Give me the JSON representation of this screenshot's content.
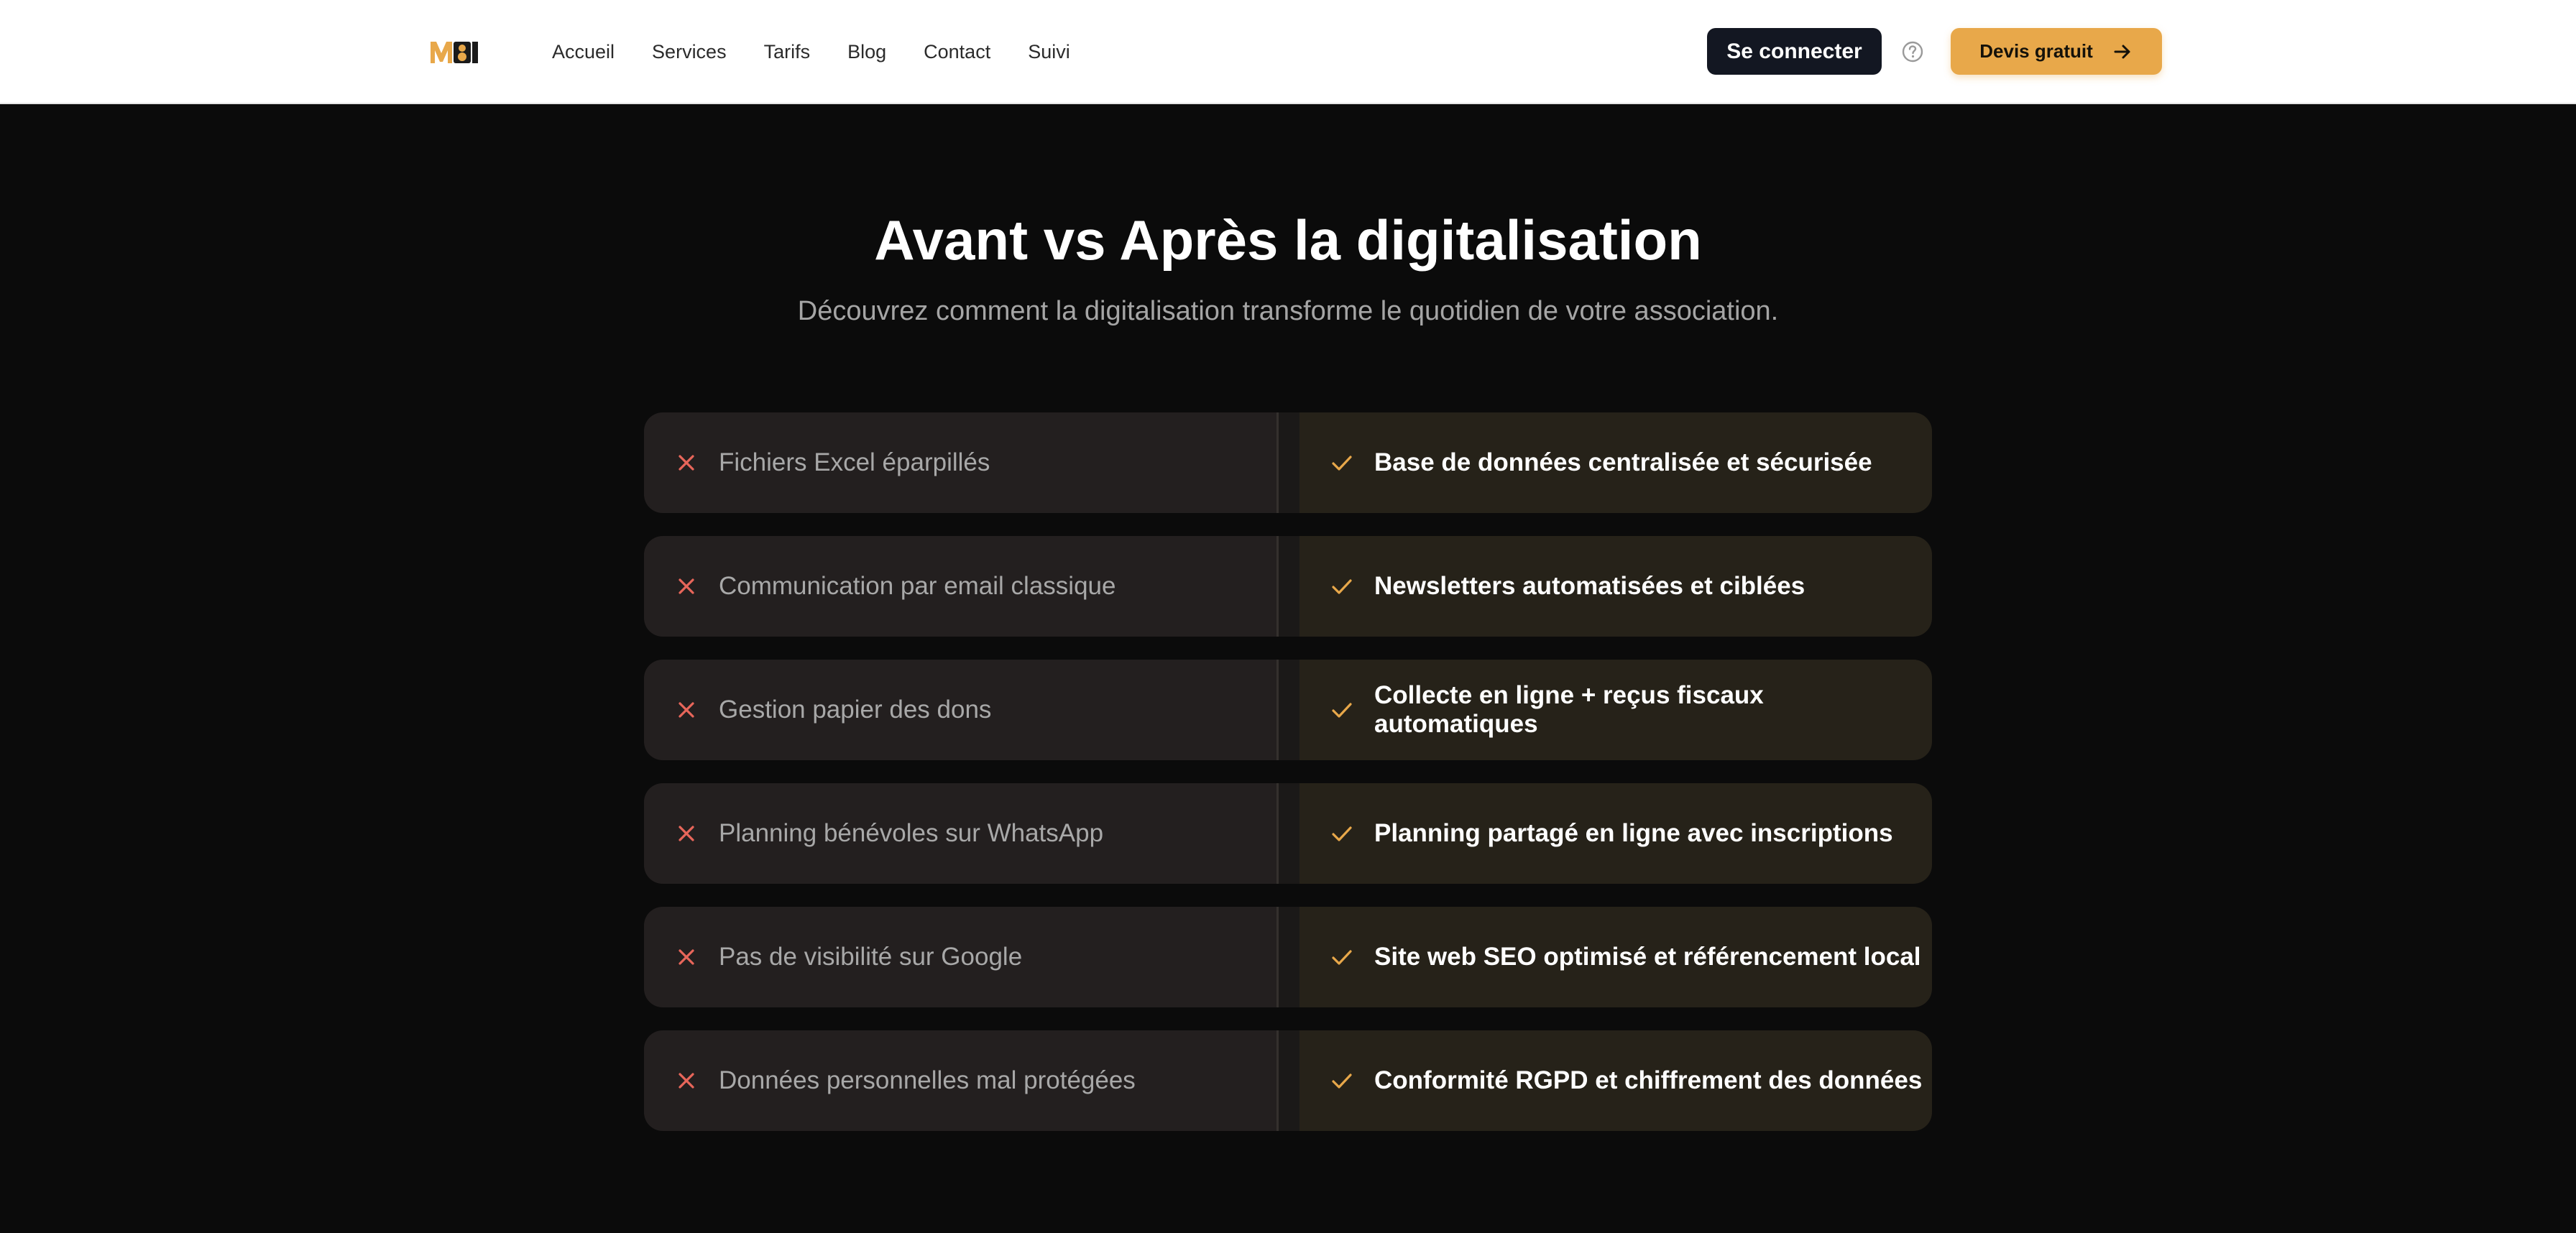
{
  "header": {
    "logo_text": "MBI",
    "nav": [
      {
        "label": "Accueil"
      },
      {
        "label": "Services"
      },
      {
        "label": "Tarifs"
      },
      {
        "label": "Blog"
      },
      {
        "label": "Contact"
      },
      {
        "label": "Suivi"
      }
    ],
    "login_label": "Se connecter",
    "help_icon": "question-circle-icon",
    "quote_label": "Devis gratuit",
    "quote_icon": "arrow-right-icon"
  },
  "colors": {
    "accent": "#e8a84a",
    "dark_button": "#131722",
    "negative_icon": "#e8665a",
    "positive_icon": "#e8a84a",
    "section_bg": "#0b0b0b"
  },
  "section": {
    "title": "Avant vs Après la digitalisation",
    "subtitle": "Découvrez comment la digitalisation transforme le quotidien de votre association.",
    "rows": [
      {
        "before": "Fichiers Excel éparpillés",
        "after": "Base de données centralisée et sécurisée"
      },
      {
        "before": "Communication par email classique",
        "after": "Newsletters automatisées et ciblées"
      },
      {
        "before": "Gestion papier des dons",
        "after": "Collecte en ligne + reçus fiscaux automatiques"
      },
      {
        "before": "Planning bénévoles sur WhatsApp",
        "after": "Planning partagé en ligne avec inscriptions"
      },
      {
        "before": "Pas de visibilité sur Google",
        "after": "Site web SEO optimisé et référencement local"
      },
      {
        "before": "Données personnelles mal protégées",
        "after": "Conformité RGPD et chiffrement des données"
      }
    ]
  }
}
